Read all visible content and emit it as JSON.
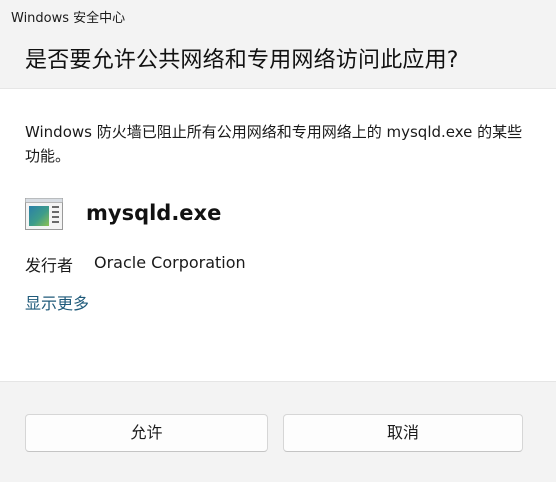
{
  "window": {
    "title": "Windows 安全中心"
  },
  "dialog": {
    "heading": "是否要允许公共网络和专用网络访问此应用?",
    "message": "Windows 防火墙已阻止所有公用网络和专用网络上的 mysqld.exe 的某些功能。",
    "app_name": "mysqld.exe",
    "app_icon": "application-window-icon",
    "publisher_label": "发行者",
    "publisher_value": "Oracle Corporation",
    "show_more": "显示更多"
  },
  "buttons": {
    "allow": "允许",
    "cancel": "取消"
  },
  "colors": {
    "link": "#1f5a7a",
    "content_bg": "#ffffff",
    "frame_bg": "#f3f3f3"
  }
}
